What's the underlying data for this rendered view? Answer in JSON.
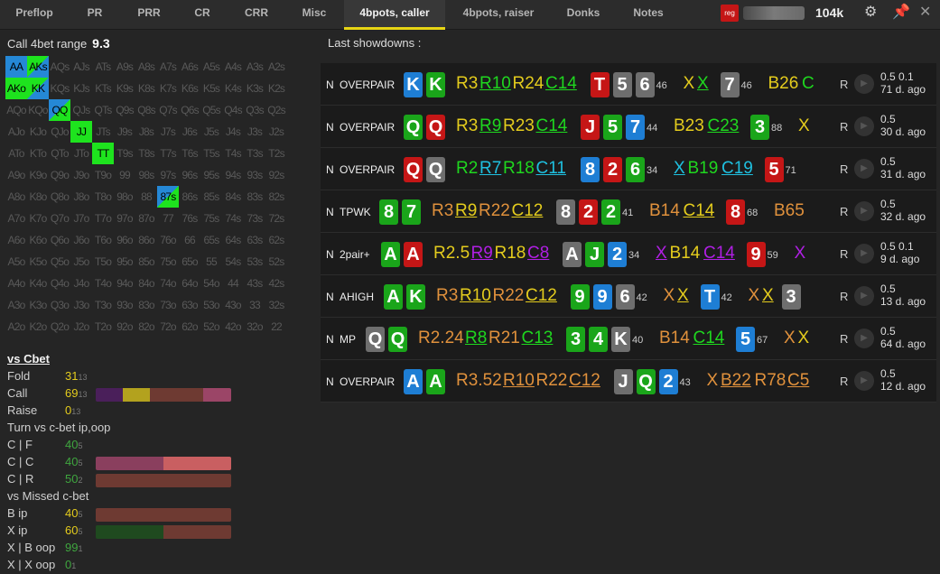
{
  "tabs": [
    "Preflop",
    "PR",
    "PRR",
    "CR",
    "CRR",
    "Misc",
    "4bpots, caller",
    "4bpots, raiser",
    "Donks",
    "Notes"
  ],
  "active_tab": "4bpots, caller",
  "badge": "reg",
  "stack": "104k",
  "range": {
    "title": "Call 4bet range",
    "value": "9.3"
  },
  "grid_rows": [
    [
      "AA",
      "AKs",
      "AQs",
      "AJs",
      "ATs",
      "A9s",
      "A8s",
      "A7s",
      "A6s",
      "A5s",
      "A4s",
      "A3s",
      "A2s"
    ],
    [
      "AKo",
      "KK",
      "KQs",
      "KJs",
      "KTs",
      "K9s",
      "K8s",
      "K7s",
      "K6s",
      "K5s",
      "K4s",
      "K3s",
      "K2s"
    ],
    [
      "AQo",
      "KQo",
      "QQ",
      "QJs",
      "QTs",
      "Q9s",
      "Q8s",
      "Q7s",
      "Q6s",
      "Q5s",
      "Q4s",
      "Q3s",
      "Q2s"
    ],
    [
      "AJo",
      "KJo",
      "QJo",
      "JJ",
      "JTs",
      "J9s",
      "J8s",
      "J7s",
      "J6s",
      "J5s",
      "J4s",
      "J3s",
      "J2s"
    ],
    [
      "ATo",
      "KTo",
      "QTo",
      "JTo",
      "TT",
      "T9s",
      "T8s",
      "T7s",
      "T6s",
      "T5s",
      "T4s",
      "T3s",
      "T2s"
    ],
    [
      "A9o",
      "K9o",
      "Q9o",
      "J9o",
      "T9o",
      "99",
      "98s",
      "97s",
      "96s",
      "95s",
      "94s",
      "93s",
      "92s"
    ],
    [
      "A8o",
      "K8o",
      "Q8o",
      "J8o",
      "T8o",
      "98o",
      "88",
      "87s",
      "86s",
      "85s",
      "84s",
      "83s",
      "82s"
    ],
    [
      "A7o",
      "K7o",
      "Q7o",
      "J7o",
      "T7o",
      "97o",
      "87o",
      "77",
      "76s",
      "75s",
      "74s",
      "73s",
      "72s"
    ],
    [
      "A6o",
      "K6o",
      "Q6o",
      "J6o",
      "T6o",
      "96o",
      "86o",
      "76o",
      "66",
      "65s",
      "64s",
      "63s",
      "62s"
    ],
    [
      "A5o",
      "K5o",
      "Q5o",
      "J5o",
      "T5o",
      "95o",
      "85o",
      "75o",
      "65o",
      "55",
      "54s",
      "53s",
      "52s"
    ],
    [
      "A4o",
      "K4o",
      "Q4o",
      "J4o",
      "T4o",
      "94o",
      "84o",
      "74o",
      "64o",
      "54o",
      "44",
      "43s",
      "42s"
    ],
    [
      "A3o",
      "K3o",
      "Q3o",
      "J3o",
      "T3o",
      "93o",
      "83o",
      "73o",
      "63o",
      "53o",
      "43o",
      "33",
      "32s"
    ],
    [
      "A2o",
      "K2o",
      "Q2o",
      "J2o",
      "T2o",
      "92o",
      "82o",
      "72o",
      "62o",
      "52o",
      "42o",
      "32o",
      "22"
    ]
  ],
  "grid_highlights": [
    {
      "hand": "AA",
      "c": "b"
    },
    {
      "hand": "AKs",
      "c": "gb"
    },
    {
      "hand": "AKo",
      "c": "g"
    },
    {
      "hand": "KK",
      "c": "gb"
    },
    {
      "hand": "QQ",
      "c": "bg"
    },
    {
      "hand": "JJ",
      "c": "g"
    },
    {
      "hand": "TT",
      "c": "g"
    },
    {
      "hand": "87s",
      "c": "bg"
    }
  ],
  "stats": {
    "vs_cbet": "vs Cbet",
    "rows": [
      {
        "label": "Fold",
        "value": "31",
        "sample": "13",
        "vc": "#e4cc1d"
      },
      {
        "label": "Call",
        "value": "69",
        "sample": "13",
        "vc": "#e4cc1d",
        "bar": [
          [
            "#4a1f5a",
            20
          ],
          [
            "#b3a21e",
            20
          ],
          [
            "#6e3a32",
            39
          ],
          [
            "#9b4567",
            21
          ]
        ]
      },
      {
        "label": "Raise",
        "value": "0",
        "sample": "13",
        "vc": "#e4cc1d"
      }
    ],
    "turn_title": "Turn vs c-bet ip,oop",
    "turn_rows": [
      {
        "label": "C | F",
        "value": "40",
        "sample": "5",
        "vc": "#3fa63f"
      },
      {
        "label": "C | C",
        "value": "40",
        "sample": "5",
        "vc": "#3fa63f",
        "bar": [
          [
            "#8a3f5e",
            50
          ],
          [
            "#c95f61",
            50
          ]
        ]
      },
      {
        "label": "C | R",
        "value": "50",
        "sample": "2",
        "vc": "#3fa63f",
        "bar": [
          [
            "#6e3a32",
            100
          ]
        ]
      }
    ],
    "missed_title": "vs Missed c-bet",
    "missed_rows": [
      {
        "label": "B ip",
        "value": "40",
        "sample": "5",
        "vc": "#e4cc1d",
        "bar": [
          [
            "#6e3a32",
            100
          ]
        ]
      },
      {
        "label": "X ip",
        "value": "60",
        "sample": "5",
        "vc": "#e4cc1d",
        "bar": [
          [
            "#1f4a1f",
            50
          ],
          [
            "#6e3a32",
            50
          ]
        ]
      },
      {
        "label": "X | B oop",
        "value": "99",
        "sample": "1",
        "vc": "#3fa63f"
      },
      {
        "label": "X | X oop",
        "value": "0",
        "sample": "1",
        "vc": "#3fa63f"
      }
    ]
  },
  "showdowns_title": "Last showdowns :",
  "hands": [
    {
      "pos": "N",
      "type": "OVERPAIR",
      "cards": [
        [
          "K",
          "d"
        ],
        [
          "K",
          "c"
        ]
      ],
      "actions": [
        [
          "R3",
          "y"
        ],
        [
          "R10",
          "gr u"
        ],
        [
          "R24",
          "y"
        ],
        [
          "C14",
          "gr u"
        ]
      ],
      "board1": [
        [
          "T",
          "h"
        ],
        [
          "5",
          "s"
        ],
        [
          "6",
          "s"
        ]
      ],
      "n1": "46",
      "a2": [
        [
          "X",
          "y"
        ],
        [
          "X",
          "gr u"
        ]
      ],
      "board2": [
        [
          "7",
          "s"
        ]
      ],
      "n2": "46",
      "a3": [
        [
          "B26",
          "y"
        ],
        [
          "C",
          "gr"
        ]
      ],
      "info": [
        "0.5 0.1",
        "71 d. ago"
      ]
    },
    {
      "pos": "N",
      "type": "OVERPAIR",
      "cards": [
        [
          "Q",
          "c"
        ],
        [
          "Q",
          "h"
        ]
      ],
      "actions": [
        [
          "R3",
          "y"
        ],
        [
          "R9",
          "gr u"
        ],
        [
          "R23",
          "y"
        ],
        [
          "C14",
          "gr u"
        ]
      ],
      "board1": [
        [
          "J",
          "h"
        ],
        [
          "5",
          "c"
        ],
        [
          "7",
          "d"
        ]
      ],
      "n1": "44",
      "a2": [
        [
          "B23",
          "y"
        ],
        [
          "C23",
          "gr u"
        ]
      ],
      "board2": [
        [
          "3",
          "c"
        ]
      ],
      "n2": "88",
      "a3": [
        [
          "X",
          "y"
        ]
      ],
      "info": [
        "0.5",
        "30 d. ago"
      ]
    },
    {
      "pos": "N",
      "type": "OVERPAIR",
      "cards": [
        [
          "Q",
          "h"
        ],
        [
          "Q",
          "s"
        ]
      ],
      "actions": [
        [
          "R2",
          "gr"
        ],
        [
          "R7",
          "cy u"
        ],
        [
          "R18",
          "gr"
        ],
        [
          "C11",
          "cy u"
        ]
      ],
      "board1": [
        [
          "8",
          "d"
        ],
        [
          "2",
          "h"
        ],
        [
          "6",
          "c"
        ]
      ],
      "n1": "34",
      "a2": [
        [
          "X",
          "cy u"
        ],
        [
          "B19",
          "gr"
        ],
        [
          "C19",
          "cy u"
        ]
      ],
      "board2": [
        [
          "5",
          "h"
        ]
      ],
      "n2": "71",
      "a3": [],
      "info": [
        "0.5",
        "31 d. ago"
      ]
    },
    {
      "pos": "N",
      "type": "TPWK",
      "cards": [
        [
          "8",
          "c"
        ],
        [
          "7",
          "c"
        ]
      ],
      "actions": [
        [
          "R3",
          "o"
        ],
        [
          "R9",
          "y u"
        ],
        [
          "R22",
          "o"
        ],
        [
          "C12",
          "y u"
        ]
      ],
      "board1": [
        [
          "8",
          "s"
        ],
        [
          "2",
          "h"
        ],
        [
          "2",
          "c"
        ]
      ],
      "n1": "41",
      "a2": [
        [
          "B14",
          "o"
        ],
        [
          "C14",
          "y u"
        ]
      ],
      "board2": [
        [
          "8",
          "h"
        ]
      ],
      "n2": "68",
      "a3": [
        [
          "B65",
          "o"
        ]
      ],
      "info": [
        "0.5",
        "32 d. ago"
      ]
    },
    {
      "pos": "N",
      "type": "2pair+",
      "cards": [
        [
          "A",
          "c"
        ],
        [
          "A",
          "h"
        ]
      ],
      "actions": [
        [
          "R2.5",
          "y"
        ],
        [
          "R9",
          "pu u"
        ],
        [
          "R18",
          "y"
        ],
        [
          "C8",
          "pu u"
        ]
      ],
      "board1": [
        [
          "A",
          "s"
        ],
        [
          "J",
          "c"
        ],
        [
          "2",
          "d"
        ]
      ],
      "n1": "34",
      "a2": [
        [
          "X",
          "pu u"
        ],
        [
          "B14",
          "y"
        ],
        [
          "C14",
          "pu u"
        ]
      ],
      "board2": [
        [
          "9",
          "h"
        ]
      ],
      "n2": "59",
      "a3": [
        [
          "X",
          "pu"
        ]
      ],
      "info": [
        "0.5 0.1",
        "9 d. ago"
      ]
    },
    {
      "pos": "N",
      "type": "AHIGH",
      "cards": [
        [
          "A",
          "c"
        ],
        [
          "K",
          "c"
        ]
      ],
      "actions": [
        [
          "R3",
          "o"
        ],
        [
          "R10",
          "y u"
        ],
        [
          "R22",
          "o"
        ],
        [
          "C12",
          "y u"
        ]
      ],
      "board1": [
        [
          "9",
          "c"
        ],
        [
          "9",
          "d"
        ],
        [
          "6",
          "s"
        ]
      ],
      "n1": "42",
      "a2": [
        [
          "X",
          "o"
        ],
        [
          "X",
          "y u"
        ]
      ],
      "board2": [
        [
          "T",
          "d"
        ]
      ],
      "n2": "42",
      "a3": [
        [
          "X",
          "o"
        ],
        [
          "X",
          "y u"
        ],
        [
          "3",
          "s"
        ]
      ],
      "info": [
        "0.5",
        "13 d. ago"
      ]
    },
    {
      "pos": "N",
      "type": "MP",
      "cards": [
        [
          "Q",
          "s"
        ],
        [
          "Q",
          "c"
        ]
      ],
      "actions": [
        [
          "R2.24",
          "o"
        ],
        [
          "R8",
          "gr u"
        ],
        [
          "R21",
          "o"
        ],
        [
          "C13",
          "gr u"
        ]
      ],
      "board1": [
        [
          "3",
          "c"
        ],
        [
          "4",
          "c"
        ],
        [
          "K",
          "s"
        ]
      ],
      "n1": "40",
      "a2": [
        [
          "B14",
          "o"
        ],
        [
          "C14",
          "gr u"
        ]
      ],
      "board2": [
        [
          "5",
          "d"
        ]
      ],
      "n2": "67",
      "a3": [
        [
          "X",
          "o"
        ],
        [
          "X",
          "y"
        ]
      ],
      "info": [
        "0.5",
        "64 d. ago"
      ]
    },
    {
      "pos": "N",
      "type": "OVERPAIR",
      "cards": [
        [
          "A",
          "d"
        ],
        [
          "A",
          "c"
        ]
      ],
      "actions": [
        [
          "R3.52",
          "o"
        ],
        [
          "R10",
          "o u"
        ],
        [
          "R22",
          "o"
        ],
        [
          "C12",
          "o u"
        ]
      ],
      "board1": [
        [
          "J",
          "s"
        ],
        [
          "Q",
          "c"
        ],
        [
          "2",
          "d"
        ]
      ],
      "n1": "43",
      "a2": [
        [
          "X",
          "o"
        ],
        [
          "B22",
          "o u"
        ],
        [
          "R78",
          "o"
        ],
        [
          "C5",
          "o u"
        ]
      ],
      "board2": [],
      "n2": "",
      "a3": [],
      "info": [
        "0.5",
        "12 d. ago"
      ]
    }
  ]
}
